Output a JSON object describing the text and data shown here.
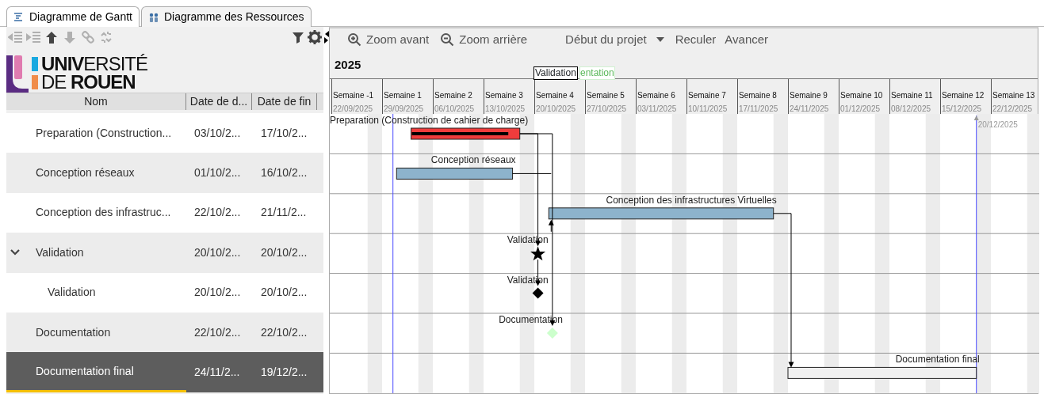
{
  "tabs": [
    {
      "label": "Diagramme de Gantt",
      "kind": "gantt",
      "selected": true
    },
    {
      "label": "Diagramme des Ressources",
      "kind": "resources",
      "selected": false
    }
  ],
  "logo": {
    "line_1": "**UNIV**ERSITÉ",
    "line_2": "DE **ROUEN**"
  },
  "table": {
    "columns": [
      "Nom",
      "Date de d...",
      "Date de fin"
    ],
    "rows": [
      {
        "name": "Preparation (Construction...",
        "start": "03/10/2...",
        "end": "17/10/2...",
        "kind": "task",
        "color": "#f03c3c",
        "level": 0.9,
        "chart_label": "Preparation (Construction de cahier de charge)",
        "selected": false
      },
      {
        "name": "Conception réseaux",
        "start": "01/10/2...",
        "end": "16/10/2...",
        "kind": "task",
        "color": "#8db3cc",
        "chart_label": "Conception réseaux",
        "selected": false
      },
      {
        "name": "Conception des infrastruc...",
        "start": "22/10/2...",
        "end": "21/11/2...",
        "kind": "task",
        "color": "#8db3cc",
        "chart_label": "Conception des infrastructures Virtuelles",
        "selected": false
      },
      {
        "name": "Validation",
        "start": "20/10/2...",
        "end": "20/10/2...",
        "kind": "summary",
        "color": "#000000",
        "chart_label": "Validation",
        "selected": false,
        "expanded": true,
        "children": [
          {
            "name": "Validation",
            "start": "20/10/2...",
            "end": "20/10/2...",
            "kind": "milestone",
            "color": "#000000",
            "chart_label": "Validation",
            "selected": false
          }
        ]
      },
      {
        "name": "Documentation",
        "start": "22/10/2...",
        "end": "22/10/2...",
        "kind": "milestone",
        "color": "#ccffcc",
        "chart_label": "Documentation",
        "selected": false
      },
      {
        "name": "Documentation final",
        "start": "24/11/2...",
        "end": "19/12/2...",
        "kind": "task",
        "color": "#f0f0f0",
        "chart_label": "Documentation final",
        "selected": true
      }
    ]
  },
  "chart_toolbar": [
    {
      "label": "Zoom avant",
      "kind": "zoom-in"
    },
    {
      "label": "Zoom arrière",
      "kind": "zoom-out"
    },
    {
      "label": "Début du projet",
      "kind": "text"
    },
    {
      "kind": "dropdown"
    },
    {
      "label": "Reculer",
      "kind": "text"
    },
    {
      "label": "Avancer",
      "kind": "text"
    }
  ],
  "timeline": {
    "year": "2025",
    "overlay_labels": [
      {
        "text": "Validation",
        "kind": "boxed"
      },
      {
        "text": "entation",
        "kind": "faded"
      }
    ],
    "weeks": [
      {
        "label": "Semaine -1",
        "date": "22/09/2025"
      },
      {
        "label": "Semaine 1",
        "date": "29/09/2025"
      },
      {
        "label": "Semaine 2",
        "date": "06/10/2025"
      },
      {
        "label": "Semaine 3",
        "date": "13/10/2025"
      },
      {
        "label": "Semaine 4",
        "date": "20/10/2025"
      },
      {
        "label": "Semaine 5",
        "date": "27/10/2025"
      },
      {
        "label": "Semaine 6",
        "date": "03/11/2025"
      },
      {
        "label": "Semaine 7",
        "date": "10/11/2025"
      },
      {
        "label": "Semaine 8",
        "date": "17/11/2025"
      },
      {
        "label": "Semaine 9",
        "date": "24/11/2025"
      },
      {
        "label": "Semaine 10",
        "date": "01/12/2025"
      },
      {
        "label": "Semaine 11",
        "date": "08/12/2025"
      },
      {
        "label": "Semaine 12",
        "date": "15/12/2025"
      },
      {
        "label": "Semaine 13",
        "date": "22/12/2025"
      }
    ],
    "end_marker": "20/12/2025"
  }
}
